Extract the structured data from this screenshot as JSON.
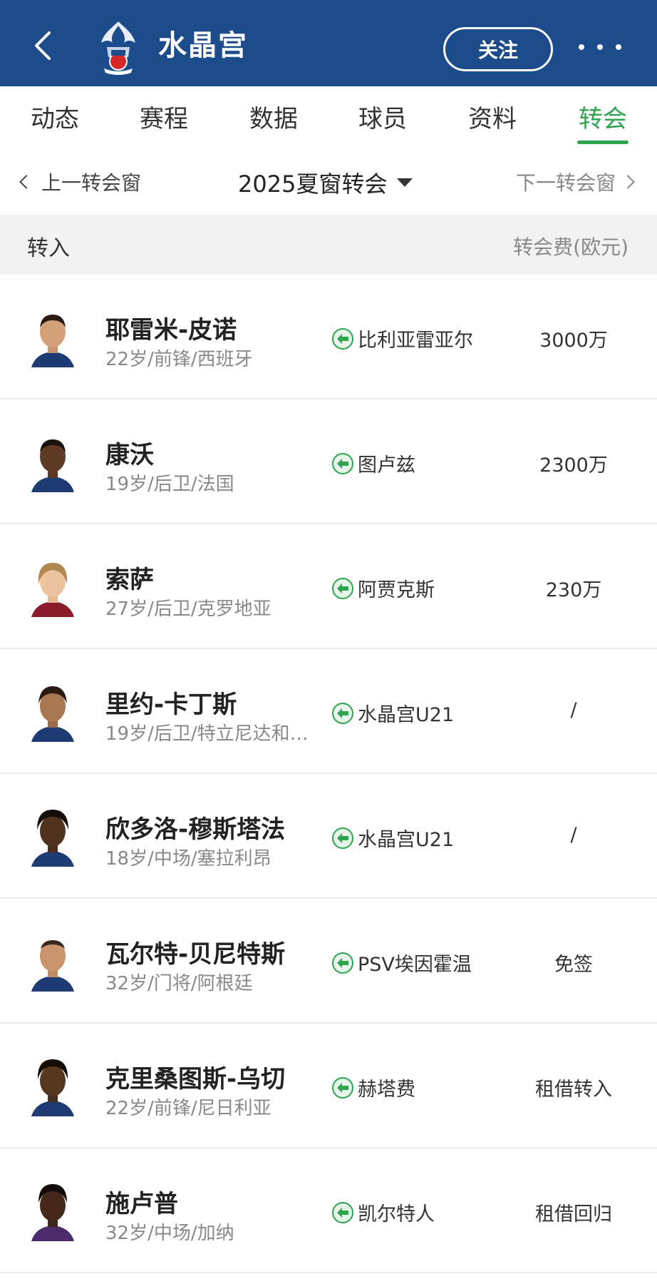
{
  "header": {
    "team_name": "水晶宫",
    "follow_label": "关注",
    "bg_color": "#1d4c8c"
  },
  "tabs": [
    {
      "label": "动态"
    },
    {
      "label": "赛程"
    },
    {
      "label": "数据"
    },
    {
      "label": "球员"
    },
    {
      "label": "资料"
    },
    {
      "label": "转会",
      "active": true
    }
  ],
  "accent_color": "#2ea44f",
  "window": {
    "prev_label": "上一转会窗",
    "current_label": "2025夏窗转会",
    "next_label": "下一转会窗"
  },
  "section": {
    "title": "转入",
    "fee_header": "转会费(欧元)"
  },
  "players": [
    {
      "name": "耶雷米-皮诺",
      "info": "22岁/前锋/西班牙",
      "from": "比利亚雷亚尔",
      "fee": "3000万"
    },
    {
      "name": "康沃",
      "info": "19岁/后卫/法国",
      "from": "图卢兹",
      "fee": "2300万"
    },
    {
      "name": "索萨",
      "info": "27岁/后卫/克罗地亚",
      "from": "阿贾克斯",
      "fee": "230万"
    },
    {
      "name": "里约-卡丁斯",
      "info": "19岁/后卫/特立尼达和…",
      "from": "水晶宫U21",
      "fee": "/"
    },
    {
      "name": "欣多洛-穆斯塔法",
      "info": "18岁/中场/塞拉利昂",
      "from": "水晶宫U21",
      "fee": "/"
    },
    {
      "name": "瓦尔特-贝尼特斯",
      "info": "32岁/门将/阿根廷",
      "from": "PSV埃因霍温",
      "fee": "免签"
    },
    {
      "name": "克里桑图斯-乌切",
      "info": "22岁/前锋/尼日利亚",
      "from": "赫塔费",
      "fee": "租借转入"
    },
    {
      "name": "施卢普",
      "info": "32岁/中场/加纳",
      "from": "凯尔特人",
      "fee": "租借回归"
    }
  ]
}
